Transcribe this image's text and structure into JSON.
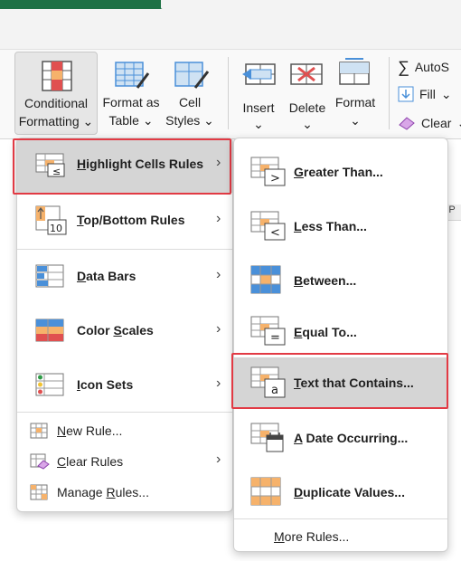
{
  "ribbon": {
    "conditional_formatting": {
      "line1": "Conditional",
      "line2": "Formatting"
    },
    "format_as_table": {
      "line1": "Format as",
      "line2": "Table"
    },
    "cell_styles": {
      "line1": "Cell",
      "line2": "Styles"
    },
    "insert": "Insert",
    "delete": "Delete",
    "format": "Format",
    "autosum": "AutoS",
    "fill": "Fill",
    "clear": "Clear",
    "chevron": "⌄"
  },
  "menu_primary": {
    "items": [
      {
        "label_u": "H",
        "label_rest": "ighlight Cells Rules",
        "icon": "highlight-cells-icon"
      },
      {
        "label_u": "T",
        "label_rest": "op/Bottom Rules",
        "icon": "top-bottom-icon"
      },
      {
        "label_u": "D",
        "label_rest": "ata Bars",
        "icon": "data-bars-icon"
      },
      {
        "label_pre": "Color ",
        "label_u": "S",
        "label_rest": "cales",
        "icon": "color-scales-icon"
      },
      {
        "label_u": "I",
        "label_rest": "con Sets",
        "icon": "icon-sets-icon"
      }
    ],
    "small_items": [
      {
        "label_u": "N",
        "label_rest": "ew Rule...",
        "icon": "new-rule-icon"
      },
      {
        "label_u": "C",
        "label_rest": "lear Rules",
        "icon": "clear-rules-icon"
      },
      {
        "label_pre": "Manage ",
        "label_u": "R",
        "label_rest": "ules...",
        "icon": "manage-rules-icon"
      }
    ]
  },
  "menu_secondary": {
    "items": [
      {
        "label_u": "G",
        "label_rest": "reater Than...",
        "icon": "greater-than-icon"
      },
      {
        "label_u": "L",
        "label_rest": "ess Than...",
        "icon": "less-than-icon"
      },
      {
        "label_u": "B",
        "label_rest": "etween...",
        "icon": "between-icon"
      },
      {
        "label_u": "E",
        "label_rest": "qual To...",
        "icon": "equal-to-icon"
      },
      {
        "label_u": "T",
        "label_rest": "ext that Contains...",
        "icon": "text-contains-icon"
      },
      {
        "label_u": "A",
        "label_rest": " Date Occurring...",
        "icon": "date-occurring-icon"
      },
      {
        "label_u": "D",
        "label_rest": "uplicate Values...",
        "icon": "duplicate-values-icon"
      }
    ],
    "more_rules": {
      "label_u": "M",
      "label_rest": "ore Rules..."
    }
  },
  "sheet": {
    "strip_text": "P"
  },
  "colors": {
    "accent_green": "#1e7145",
    "highlight_red": "#e23a44",
    "orange": "#f6b26b",
    "blue": "#4a90d9",
    "red": "#e05050"
  }
}
